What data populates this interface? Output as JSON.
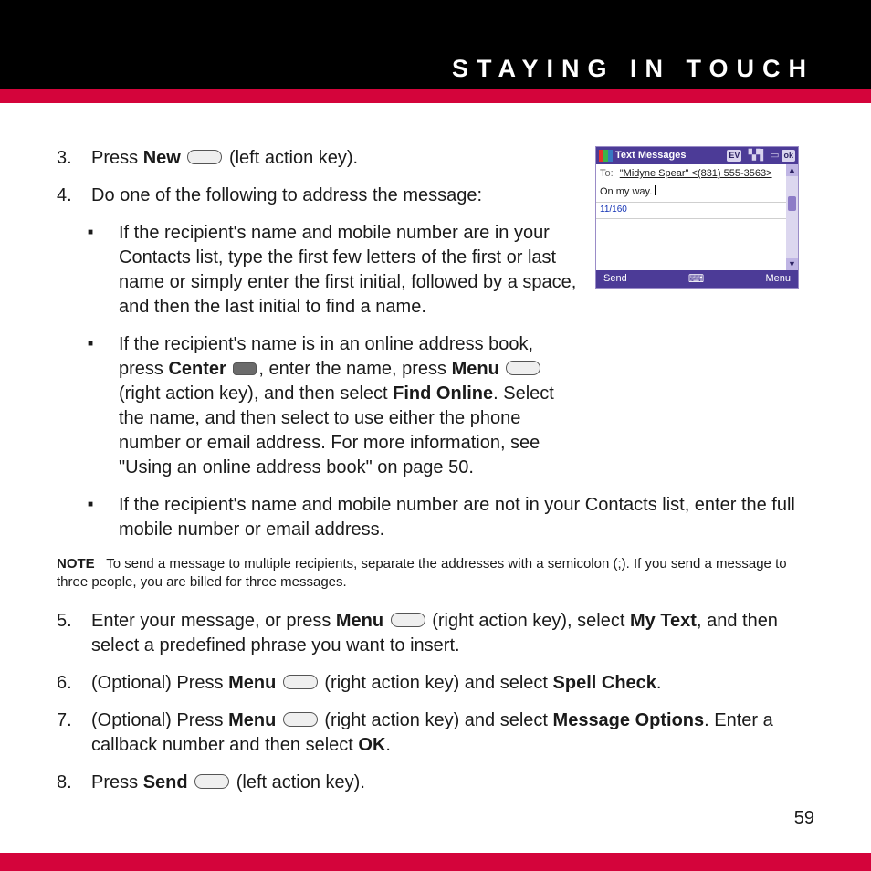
{
  "header": {
    "title": "STAYING IN TOUCH"
  },
  "steps": {
    "s3": {
      "num": "3.",
      "a": "Press ",
      "b": "New",
      "c": " (left action key)."
    },
    "s4": {
      "num": "4.",
      "text": "Do one of the following to address the message:"
    },
    "s4b1": "If the recipient's name and mobile number are in your Contacts list, type the first few letters of the first or last name or simply enter the first initial, followed by a space, and then the last initial to find a name.",
    "s4b2": {
      "a": "If the recipient's name is in an online address book, press ",
      "b": "Center",
      "c": ", enter the name, press ",
      "d": "Menu",
      "e": " (right action key), and then select ",
      "f": "Find Online",
      "g": ". Select the name, and then select to use either the phone number or email address. For more information, see \"Using an online address book\" on page 50."
    },
    "s4b3": "If the recipient's name and mobile number are not in your Contacts list, enter the full mobile number or email address.",
    "note": {
      "label": "NOTE",
      "text": "To send a message to multiple recipients, separate the addresses with a semicolon (;). If you send a message to three people, you are billed for three messages."
    },
    "s5": {
      "num": "5.",
      "a": "Enter your message, or press ",
      "b": "Menu",
      "c": " (right action key), select ",
      "d": "My Text",
      "e": ", and then select a predefined phrase you want to insert."
    },
    "s6": {
      "num": "6.",
      "a": "(Optional) Press ",
      "b": "Menu",
      "c": " (right action key) and select ",
      "d": "Spell Check",
      "e": "."
    },
    "s7": {
      "num": "7.",
      "a": "(Optional) Press ",
      "b": "Menu",
      "c": " (right action key) and select ",
      "d": "Message Options",
      "e": ". Enter a callback number and then select ",
      "f": "OK",
      "g": "."
    },
    "s8": {
      "num": "8.",
      "a": "Press ",
      "b": "Send",
      "c": " (left action key)."
    }
  },
  "screenshot": {
    "title": "Text Messages",
    "ev": "EV",
    "ok": "ok",
    "to_label": "To:",
    "to_value": "\"Midyne Spear\" <(831) 555-3563>",
    "message": "On my way.",
    "counter": "11/160",
    "softkey_left": "Send",
    "softkey_right": "Menu"
  },
  "page_number": "59"
}
